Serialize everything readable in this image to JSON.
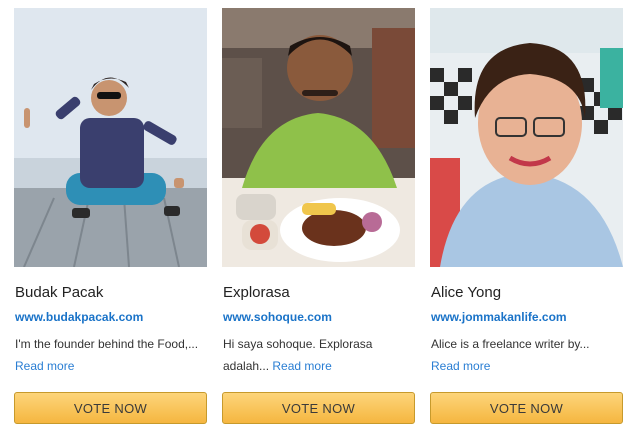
{
  "cards": [
    {
      "name": "Budak Pacak",
      "website": "www.budakpacak.com",
      "description": "I'm the founder behind the Food,...",
      "read_more": "Read more",
      "vote_label": "VOTE NOW"
    },
    {
      "name": "Explorasa",
      "website": "www.sohoque.com",
      "description": "Hi saya sohoque. Explorasa adalah...",
      "read_more": "Read more",
      "vote_label": "VOTE NOW"
    },
    {
      "name": "Alice Yong",
      "website": "www.jommakanlife.com",
      "description": "Alice is a freelance writer by...",
      "read_more": "Read more",
      "vote_label": "VOTE NOW"
    }
  ],
  "colors": {
    "link": "#1a73c8",
    "button_top": "#fdd57a",
    "button_bottom": "#f5b640"
  }
}
